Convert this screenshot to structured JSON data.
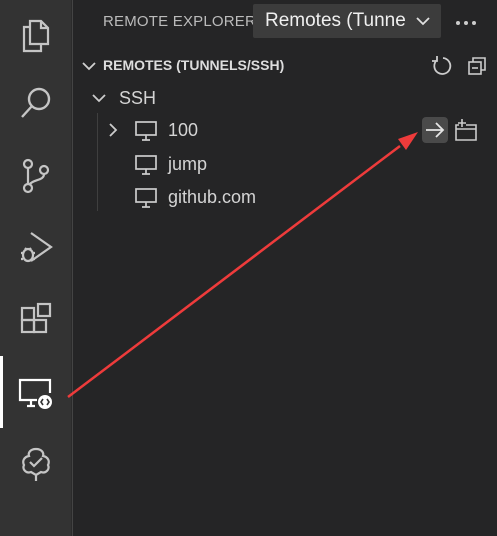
{
  "activity_bar": {
    "items": [
      {
        "icon": "files-icon",
        "active": false
      },
      {
        "icon": "search-icon",
        "active": false
      },
      {
        "icon": "source-control-icon",
        "active": false
      },
      {
        "icon": "run-debug-icon",
        "active": false
      },
      {
        "icon": "extensions-icon",
        "active": false
      },
      {
        "icon": "remote-explorer-icon",
        "active": true
      },
      {
        "icon": "tree-badge-icon",
        "active": false
      }
    ]
  },
  "sidebar": {
    "view_title": "REMOTE EXPLORER",
    "remotes_select_value": "Remotes (Tunne",
    "more_actions_label": "···",
    "section_title": "REMOTES (TUNNELS/SSH)",
    "ssh_group_label": "SSH",
    "hosts": [
      {
        "label": "100",
        "collapsible": true
      },
      {
        "label": "jump",
        "collapsible": false
      },
      {
        "label": "github.com",
        "collapsible": false
      }
    ]
  },
  "annotation": {
    "arrow_color": "#ee3b3b"
  },
  "colors": {
    "activity_bar_bg": "#333333",
    "sidebar_bg": "#252526",
    "icon_color": "#c5c5c5",
    "active_indicator": "#ffffff"
  }
}
